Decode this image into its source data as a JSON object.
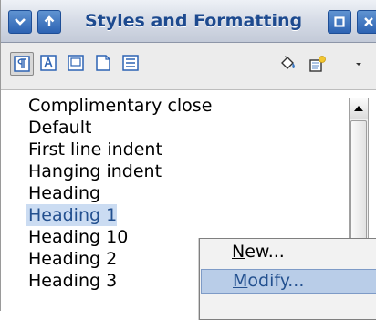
{
  "window": {
    "title": "Styles and Formatting"
  },
  "titlebar": {
    "menu_icon": "chevron-down-icon",
    "shade_icon": "arrow-up-icon",
    "restore_icon": "restore-icon",
    "close_icon": "close-icon"
  },
  "toolbar": {
    "tools": [
      {
        "name": "paragraph-styles-icon",
        "pressed": true
      },
      {
        "name": "character-styles-icon",
        "pressed": false
      },
      {
        "name": "frame-styles-icon",
        "pressed": false
      },
      {
        "name": "page-styles-icon",
        "pressed": false
      },
      {
        "name": "list-styles-icon",
        "pressed": false
      },
      {
        "name": "fill-format-mode-icon",
        "pressed": false
      },
      {
        "name": "new-style-from-selection-icon",
        "pressed": false
      },
      {
        "name": "dropdown-arrow-icon",
        "pressed": false
      }
    ]
  },
  "styles_list": {
    "items": [
      "Complimentary close",
      "Default",
      "First line indent",
      "Hanging indent",
      "Heading",
      "Heading 1",
      "Heading 10",
      "Heading 2",
      "Heading 3"
    ],
    "selected": "Heading 1"
  },
  "context_menu": {
    "items": [
      {
        "label": "New...",
        "mnemonic": "N",
        "rest": "ew...",
        "highlighted": false
      },
      {
        "label": "Modify...",
        "mnemonic": "M",
        "rest": "odify...",
        "highlighted": true
      }
    ]
  },
  "colors": {
    "accent": "#2d63b3",
    "selection_bg": "#cbdcf2",
    "selection_text": "#23508f",
    "menu_highlight": "#b9cde8"
  }
}
